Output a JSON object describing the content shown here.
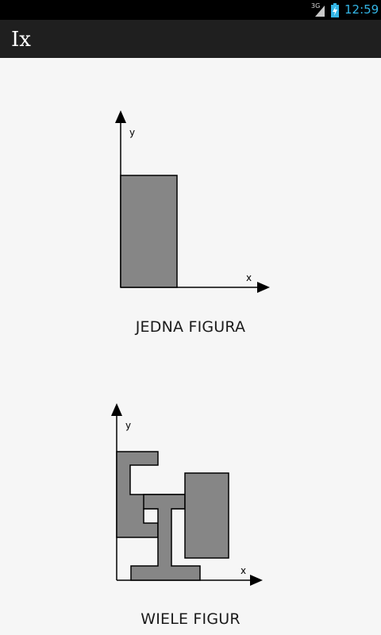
{
  "status_bar": {
    "network": "3G",
    "time": "12:59",
    "icons": [
      "signal-icon",
      "battery-charging-icon"
    ],
    "time_color": "#33b5e5"
  },
  "app": {
    "title": "Ix"
  },
  "options": [
    {
      "label": "JEDNA FIGURA",
      "diagram": {
        "x_axis_label": "x",
        "y_axis_label": "y",
        "shape": "single-rectangle",
        "fill_color": "#868686"
      }
    },
    {
      "label": "WIELE FIGUR",
      "diagram": {
        "x_axis_label": "x",
        "y_axis_label": "y",
        "shape": "composite-figures",
        "fill_color": "#868686"
      }
    }
  ]
}
